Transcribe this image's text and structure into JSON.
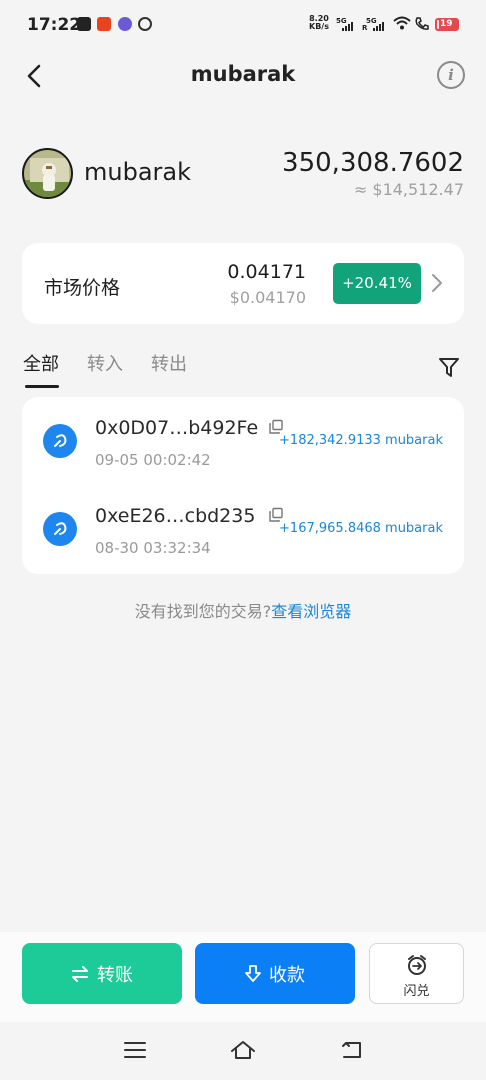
{
  "status_bar": {
    "time": "17:22",
    "net_speed_value": "8.20",
    "net_speed_unit": "KB/s",
    "sim1_label": "5G",
    "sim2_label": "5G",
    "sim2_roaming": "R",
    "battery": "19"
  },
  "header": {
    "title": "mubarak"
  },
  "token": {
    "name": "mubarak",
    "balance": "350,308.7602",
    "balance_usd": "≈ $14,512.47"
  },
  "market": {
    "label": "市场价格",
    "price": "0.04171",
    "price_usd": "$0.04170",
    "change": "+20.41%",
    "change_color": "#12a37a"
  },
  "tabs": [
    {
      "label": "全部",
      "active": true
    },
    {
      "label": "转入",
      "active": false
    },
    {
      "label": "转出",
      "active": false
    }
  ],
  "transactions": [
    {
      "address": "0x0D07…b492Fe",
      "time": "09-05 00:02:42",
      "amount": "+182,342.9133 mubarak"
    },
    {
      "address": "0xeE26…cbd235",
      "time": "08-30 03:32:34",
      "amount": "+167,965.8468 mubarak"
    }
  ],
  "footer_note": {
    "text": "没有找到您的交易?",
    "link": "查看浏览器"
  },
  "actions": {
    "transfer_label": "转账",
    "receive_label": "收款",
    "swap_label": "闪兑"
  },
  "colors": {
    "transfer": "#1dcb98",
    "receive": "#0b7ff6",
    "link": "#1b86d8"
  }
}
